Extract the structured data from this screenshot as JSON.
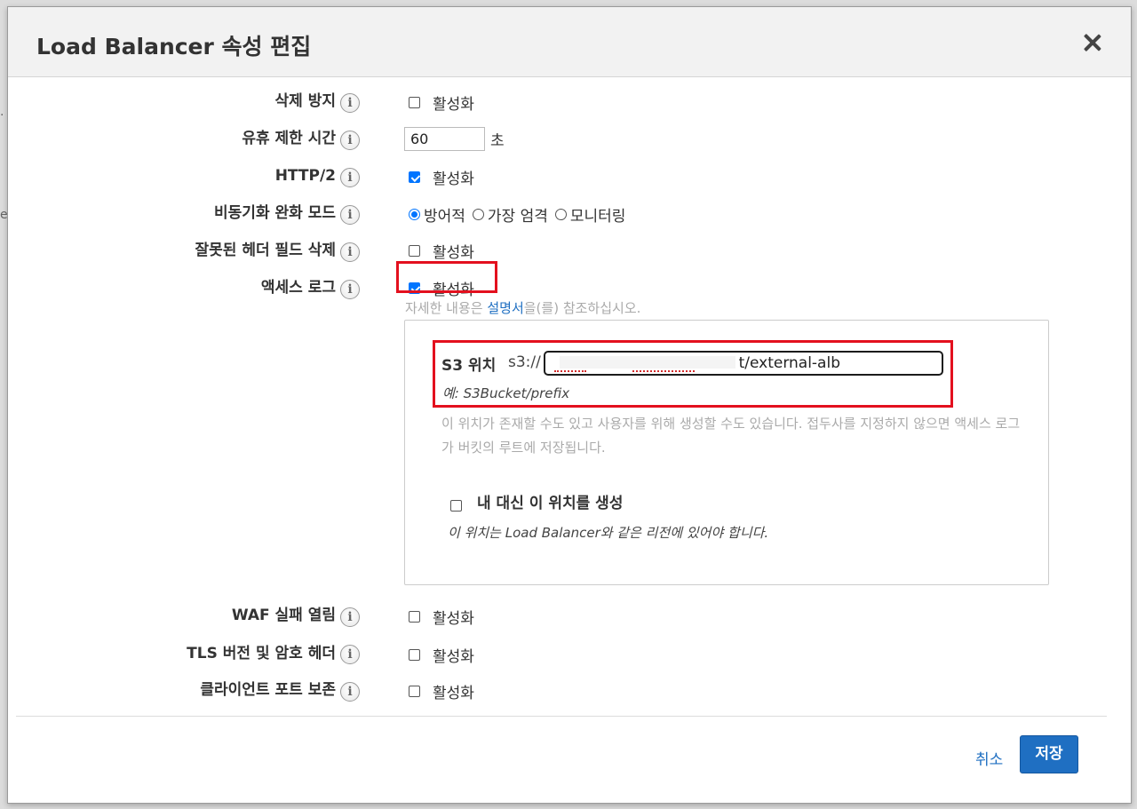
{
  "dialog": {
    "title": "Load Balancer 속성 편집"
  },
  "rows": {
    "deletion_protection": {
      "label": "삭제 방지",
      "checkbox_label": "활성화",
      "checked": false
    },
    "idle_timeout": {
      "label": "유휴 제한 시간",
      "value": "60",
      "unit": "초"
    },
    "http2": {
      "label": "HTTP/2",
      "checkbox_label": "활성화",
      "checked": true
    },
    "desync_mode": {
      "label": "비동기화 완화 모드",
      "options": [
        "방어적",
        "가장 엄격",
        "모니터링"
      ],
      "selected": "방어적"
    },
    "drop_invalid_headers": {
      "label": "잘못된 헤더 필드 삭제",
      "checkbox_label": "활성화",
      "checked": false
    },
    "access_logs": {
      "label": "액세스 로그",
      "checkbox_label": "활성화",
      "checked": true
    },
    "waf_fail_open": {
      "label": "WAF 실패 열림",
      "checkbox_label": "활성화",
      "checked": false
    },
    "tls_headers": {
      "label": "TLS 버전 및 암호 헤더",
      "checkbox_label": "활성화",
      "checked": false
    },
    "preserve_client_port": {
      "label": "클라이언트 포트 보존",
      "checkbox_label": "활성화",
      "checked": false
    }
  },
  "help": {
    "prefix": "자세한 내용은 ",
    "link": "설명서",
    "suffix": "을(를) 참조하십시오."
  },
  "s3": {
    "label": "S3 위치",
    "prefix": "s3://",
    "value": "t/external-alb",
    "example": "예: S3Bucket/prefix",
    "description": "이 위치가 존재할 수도 있고 사용자를 위해 생성할 수도 있습니다. 접두사를 지정하지 않으면 액세스 로그가 버킷의 루트에 저장됩니다.",
    "create_label": "내 대신 이 위치를 생성",
    "create_checked": false,
    "create_note": "이 위치는 Load Balancer와 같은 리전에 있어야 합니다."
  },
  "footer": {
    "cancel": "취소",
    "save": "저장"
  },
  "colors": {
    "primary": "#1f6fc2",
    "highlight": "#e3101e",
    "checkbox": "#0075ff"
  },
  "icons": {
    "info": "info-icon",
    "close": "close-icon"
  }
}
